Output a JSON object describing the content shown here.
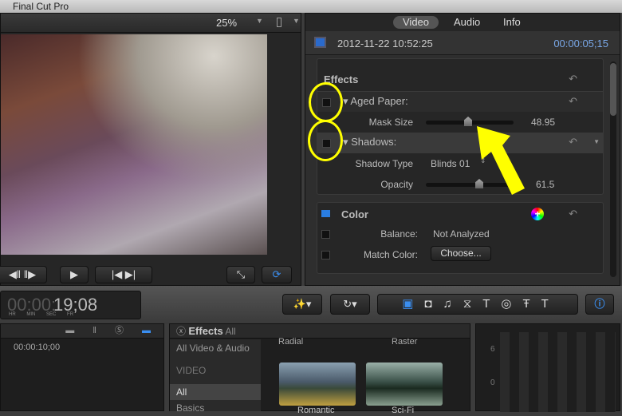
{
  "app": {
    "title": "Final Cut Pro"
  },
  "viewer": {
    "zoom": "25%"
  },
  "inspector": {
    "tabs": [
      {
        "label": "Video",
        "active": true
      },
      {
        "label": "Audio"
      },
      {
        "label": "Info"
      }
    ],
    "clip_name": "2012-11-22 10:52:25",
    "timecode": "00:00:05;15",
    "effects": {
      "title": "Effects",
      "aged_paper": {
        "label": "Aged Paper:",
        "mask_size_label": "Mask Size",
        "mask_size_value": "48.95",
        "mask_size_fraction": 0.5
      },
      "shadows": {
        "label": "Shadows:",
        "type_label": "Shadow Type",
        "type_value": "Blinds 01",
        "opacity_label": "Opacity",
        "opacity_value": "61.5",
        "opacity_fraction": 0.6
      }
    },
    "color": {
      "title": "Color",
      "balance_label": "Balance:",
      "balance_value": "Not Analyzed",
      "match_label": "Match Color:",
      "match_button": "Choose..."
    }
  },
  "accent": "#2a7de1",
  "annotation_color": "#ffff00",
  "toolbar": {
    "timecode": {
      "dim": "00:00:",
      "bright": "19;08",
      "units": [
        "HR",
        "MIN",
        "SEC",
        "FR"
      ]
    }
  },
  "timeline": {
    "ruler": "00:00:10;00"
  },
  "browser": {
    "title": "Effects",
    "filter": "All",
    "categories": [
      "All Video & Audio",
      "VIDEO",
      "All",
      "Basics"
    ],
    "items_top": [
      "Radial",
      "Raster"
    ],
    "items": [
      "Romantic",
      "Sci-Fi"
    ]
  },
  "meter": {
    "ticks": [
      "6",
      "0"
    ]
  }
}
